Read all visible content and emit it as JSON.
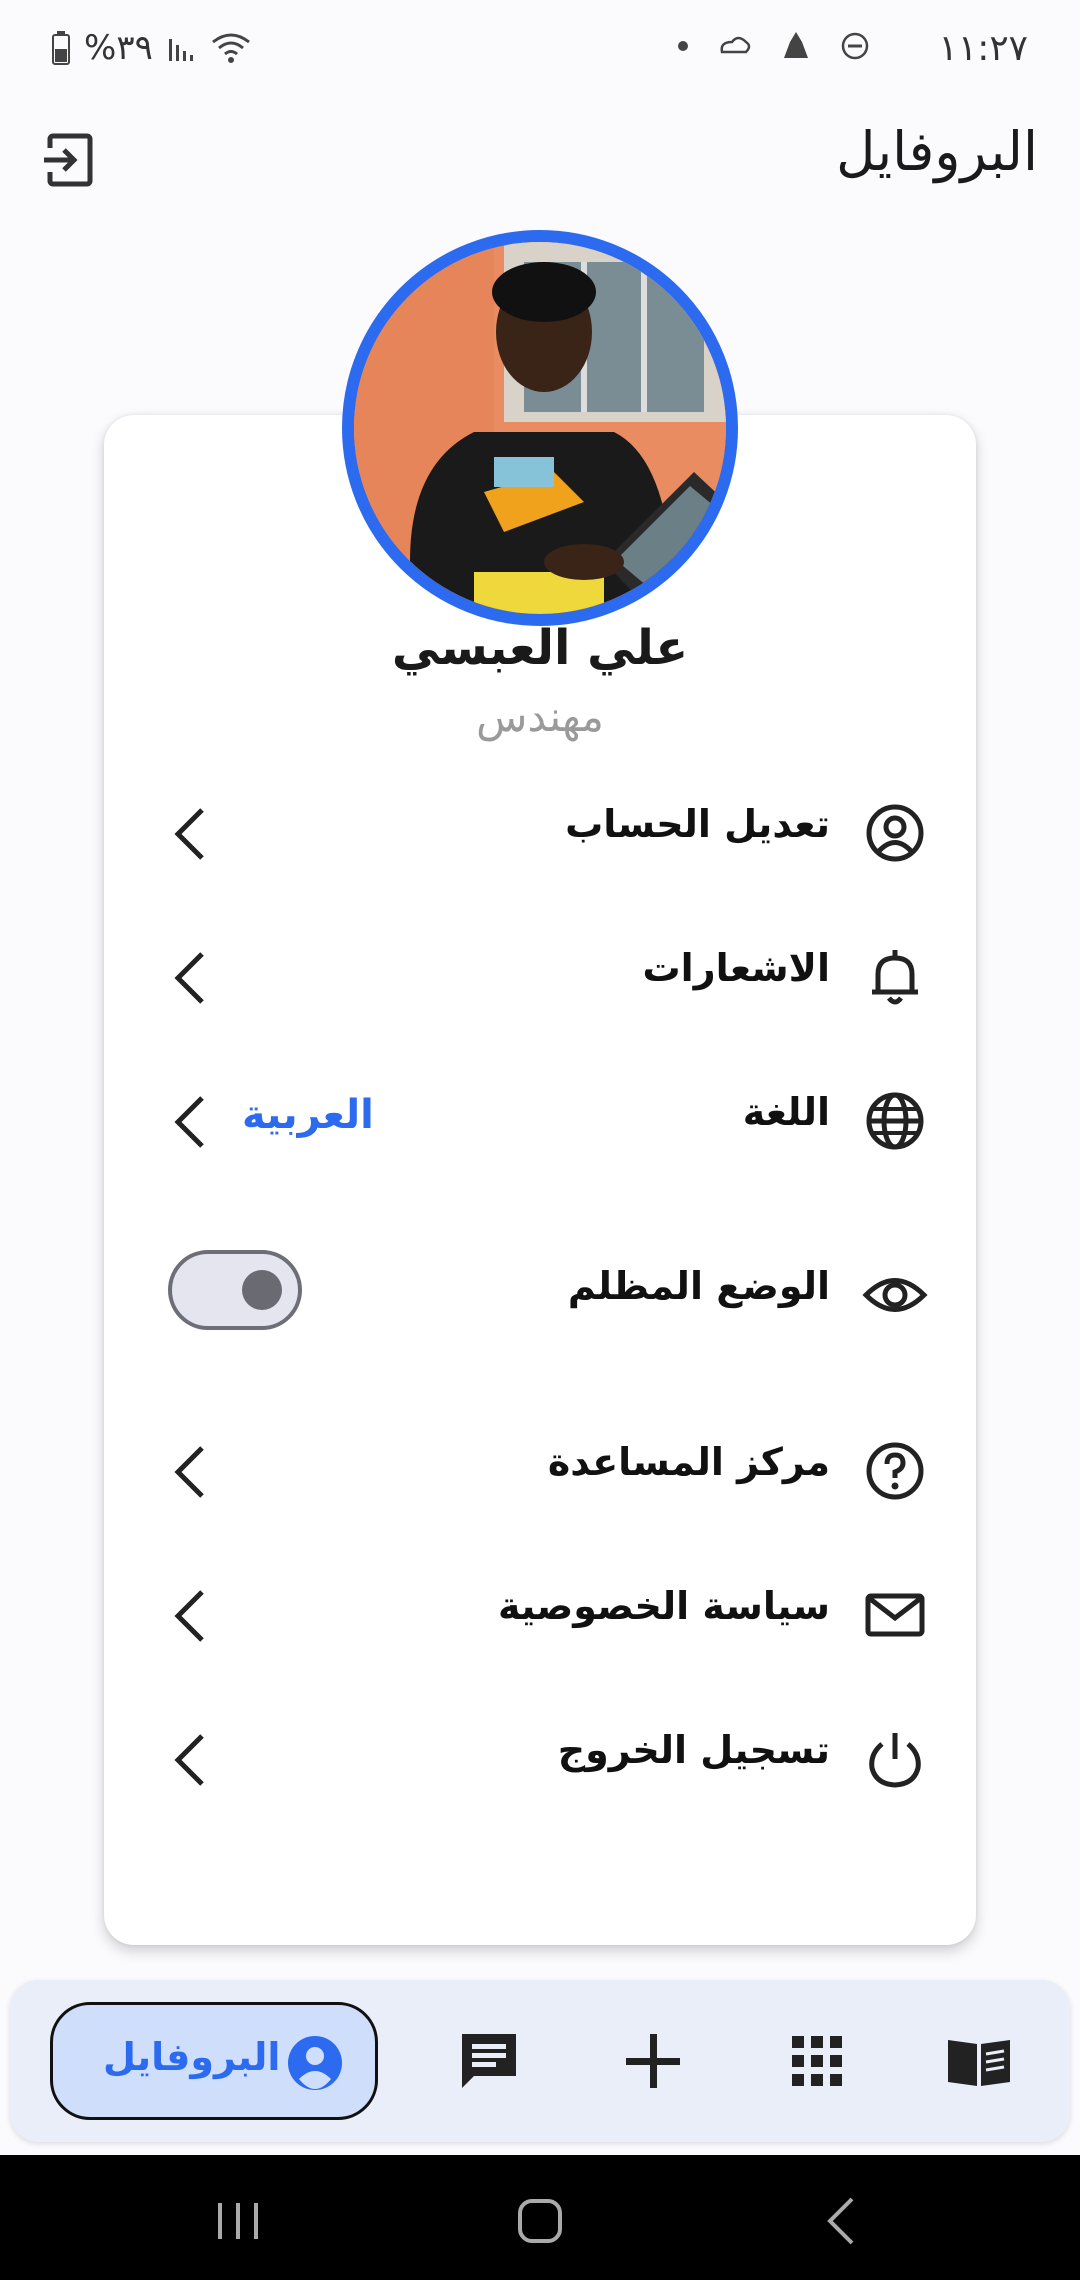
{
  "status_bar": {
    "time": "١١:٢٧",
    "battery": "%٣٩"
  },
  "header": {
    "title": "البروفايل"
  },
  "profile": {
    "name": "علي العبسي",
    "role": "مهندس"
  },
  "menu": {
    "items": [
      {
        "label": "تعديل الحساب",
        "icon": "account-circle-icon"
      },
      {
        "label": "الاشعارات",
        "icon": "bell-icon"
      },
      {
        "label": "اللغة",
        "icon": "globe-icon",
        "value": "العربية"
      },
      {
        "label": "الوضع المظلم",
        "icon": "eye-icon",
        "toggle_on": false
      },
      {
        "label": "مركز المساعدة",
        "icon": "help-icon"
      },
      {
        "label": "سياسة الخصوصية",
        "icon": "mail-icon"
      },
      {
        "label": "تسجيل الخروج",
        "icon": "power-icon"
      }
    ]
  },
  "bottom_nav": {
    "active_label": "البروفايل",
    "items": [
      "profile-icon",
      "chat-icon",
      "add-icon",
      "apps-grid-icon",
      "book-icon"
    ]
  },
  "colors": {
    "accent": "#2c6bf0",
    "nav_background": "#e9eef9",
    "active_pill": "#cfdffb"
  }
}
